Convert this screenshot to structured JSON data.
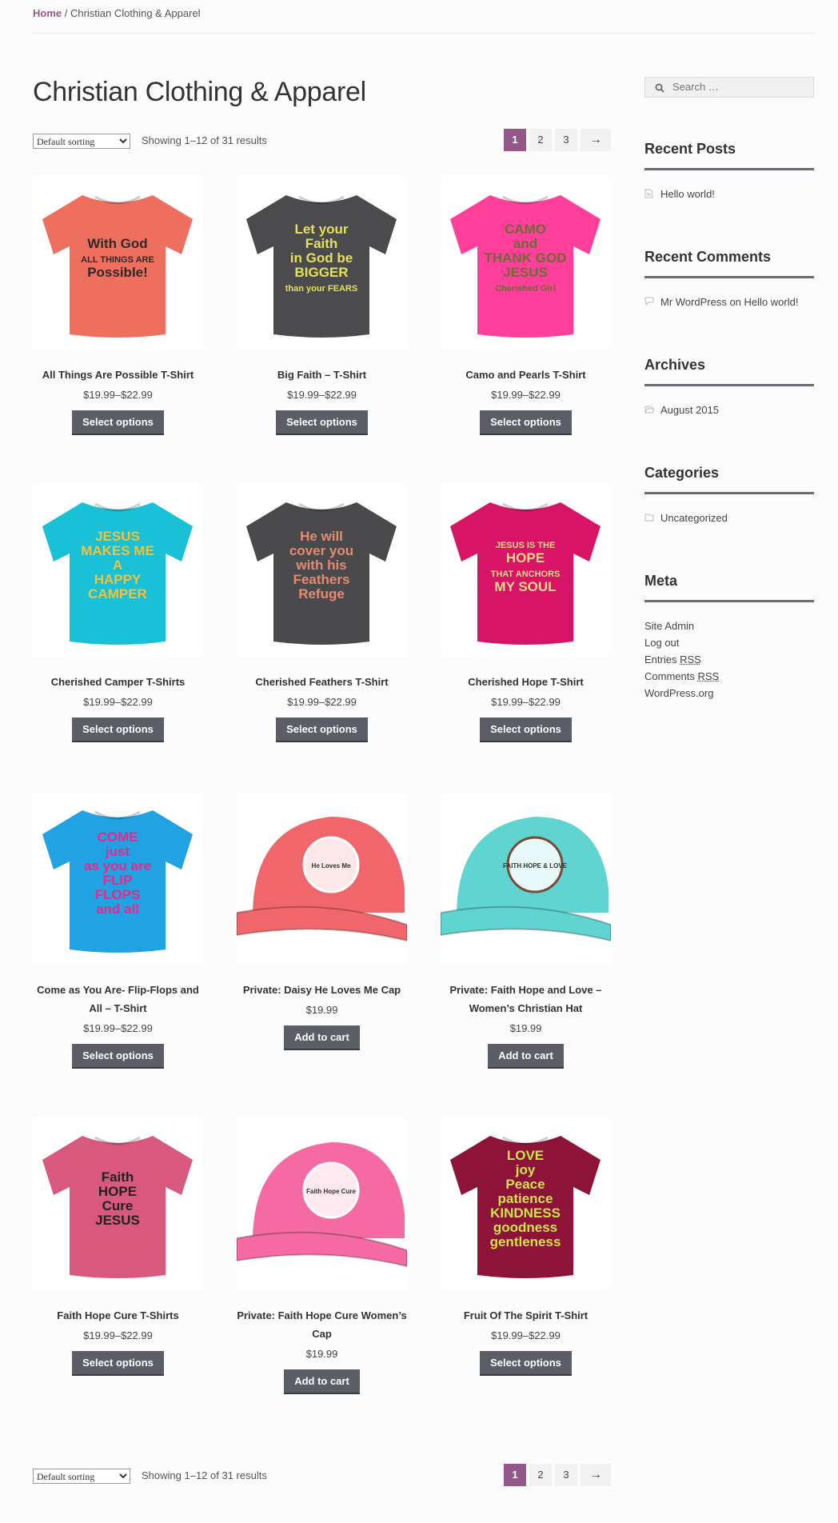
{
  "breadcrumb": {
    "home": "Home",
    "separator": " / ",
    "current": "Christian Clothing & Apparel"
  },
  "page_title": "Christian Clothing & Apparel",
  "toolbar": {
    "sorting": "Default sorting",
    "result_count": "Showing 1–12 of 31 results",
    "pages": [
      "1",
      "2",
      "3"
    ],
    "next": "→",
    "active_page": "1"
  },
  "products": [
    {
      "title": "All Things Are Possible T-Shirt",
      "price": "$19.99–$22.99",
      "button": "Select options",
      "kind": "shirt",
      "color": "#ef6f5e",
      "art_text": [
        "With God",
        "ALL THINGS ARE",
        "Possible!"
      ],
      "art_color": "#2b2b2b"
    },
    {
      "title": "Big Faith – T-Shirt",
      "price": "$19.99–$22.99",
      "button": "Select options",
      "kind": "shirt",
      "color": "#4b4b4d",
      "art_text": [
        "Let your",
        "Faith",
        "in God be",
        "BIGGER",
        "than your FEARS"
      ],
      "art_color": "#e6e15a"
    },
    {
      "title": "Camo and Pearls T-Shirt",
      "price": "$19.99–$22.99",
      "button": "Select options",
      "kind": "shirt",
      "color": "#ff3f9a",
      "art_text": [
        "CAMO",
        "and",
        "THANK GOD",
        "JESUS",
        "Cherished Girl"
      ],
      "art_color": "#6d6a34"
    },
    {
      "title": "Cherished Camper T-Shirts",
      "price": "$19.99–$22.99",
      "button": "Select options",
      "kind": "shirt",
      "color": "#19c0d6",
      "art_text": [
        "JESUS",
        "MAKES ME",
        "A",
        "HAPPY",
        "CAMPER"
      ],
      "art_color": "#f2c23a"
    },
    {
      "title": "Cherished Feathers T-Shirt",
      "price": "$19.99–$22.99",
      "button": "Select options",
      "kind": "shirt",
      "color": "#4a4a4c",
      "art_text": [
        "He will",
        "cover you",
        "with his",
        "Feathers",
        "Refuge"
      ],
      "art_color": "#e88a70"
    },
    {
      "title": "Cherished Hope T-Shirt",
      "price": "$19.99–$22.99",
      "button": "Select options",
      "kind": "shirt",
      "color": "#d81466",
      "art_text": [
        "JESUS IS THE",
        "HOPE",
        "THAT ANCHORS",
        "MY SOUL"
      ],
      "art_color": "#f1d98a"
    },
    {
      "title": "Come as You Are- Flip-Flops and All – T-Shirt",
      "price": "$19.99–$22.99",
      "button": "Select options",
      "kind": "shirt",
      "color": "#21a2e2",
      "art_text": [
        "COME",
        "just",
        "as you are",
        "FLIP",
        "FLOPS",
        "and all"
      ],
      "art_color": "#e72a8c"
    },
    {
      "title": "Private: Daisy He Loves Me Cap",
      "price": "$19.99",
      "button": "Add to cart",
      "kind": "cap",
      "color": "#f0666b",
      "art_text": [
        "He Loves Me"
      ],
      "art_color": "#ffffff"
    },
    {
      "title": "Private: Faith Hope and Love – Women’s Christian Hat",
      "price": "$19.99",
      "button": "Add to cart",
      "kind": "cap",
      "color": "#5fd4d0",
      "art_text": [
        "FAITH HOPE & LOVE"
      ],
      "art_color": "#7a4a36"
    },
    {
      "title": "Faith Hope Cure T-Shirts",
      "price": "$19.99–$22.99",
      "button": "Select options",
      "kind": "shirt",
      "color": "#d9587e",
      "art_text": [
        "Faith",
        "HOPE",
        "Cure",
        "JESUS"
      ],
      "art_color": "#222222"
    },
    {
      "title": "Private: Faith Hope Cure Women’s Cap",
      "price": "$19.99",
      "button": "Add to cart",
      "kind": "cap",
      "color": "#f56aa3",
      "art_text": [
        "Faith Hope Cure"
      ],
      "art_color": "#ffffff"
    },
    {
      "title": "Fruit Of The Spirit T-Shirt",
      "price": "$19.99–$22.99",
      "button": "Select options",
      "kind": "shirt",
      "color": "#8e1338",
      "art_text": [
        "LOVE",
        "joy",
        "Peace",
        "patience",
        "KINDNESS",
        "goodness",
        "gentleness"
      ],
      "art_color": "#cfe34a"
    }
  ],
  "sidebar": {
    "search_placeholder": "Search …",
    "recent_posts": {
      "title": "Recent Posts",
      "items": [
        "Hello world!"
      ]
    },
    "recent_comments": {
      "title": "Recent Comments",
      "author": "Mr WordPress",
      "on": " on ",
      "post": "Hello world!"
    },
    "archives": {
      "title": "Archives",
      "items": [
        "August 2015"
      ]
    },
    "categories": {
      "title": "Categories",
      "items": [
        "Uncategorized"
      ]
    },
    "meta": {
      "title": "Meta",
      "site_admin": "Site Admin",
      "log_out": "Log out",
      "entries": "Entries ",
      "comments": "Comments ",
      "rss": "RSS",
      "wordpress": "WordPress.org"
    }
  },
  "colors": {
    "accent": "#96588a",
    "button": "#5b5e66",
    "pager_bg": "#f2f2f2"
  }
}
